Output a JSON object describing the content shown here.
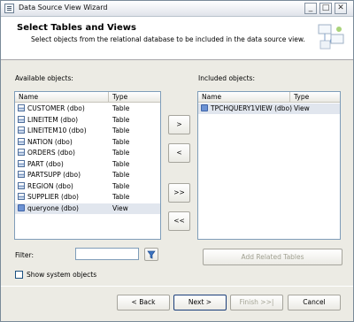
{
  "window": {
    "title": "Data Source View Wizard",
    "minimize": "_",
    "maximize": "□",
    "close": "✕"
  },
  "header": {
    "title": "Select Tables and Views",
    "subtitle": "Select objects from the relational database to be included in the data source view."
  },
  "available": {
    "label": "Available objects:",
    "columns": {
      "name": "Name",
      "type": "Type"
    },
    "rows": [
      {
        "name": "CUSTOMER (dbo)",
        "type": "Table",
        "icon": "table-icon"
      },
      {
        "name": "LINEITEM (dbo)",
        "type": "Table",
        "icon": "table-icon"
      },
      {
        "name": "LINEITEM10 (dbo)",
        "type": "Table",
        "icon": "table-icon"
      },
      {
        "name": "NATION (dbo)",
        "type": "Table",
        "icon": "table-icon"
      },
      {
        "name": "ORDERS (dbo)",
        "type": "Table",
        "icon": "table-icon"
      },
      {
        "name": "PART (dbo)",
        "type": "Table",
        "icon": "table-icon"
      },
      {
        "name": "PARTSUPP (dbo)",
        "type": "Table",
        "icon": "table-icon"
      },
      {
        "name": "REGION (dbo)",
        "type": "Table",
        "icon": "table-icon"
      },
      {
        "name": "SUPPLIER (dbo)",
        "type": "Table",
        "icon": "table-icon"
      },
      {
        "name": "queryone (dbo)",
        "type": "View",
        "icon": "view-icon"
      }
    ]
  },
  "included": {
    "label": "Included objects:",
    "columns": {
      "name": "Name",
      "type": "Type"
    },
    "rows": [
      {
        "name": "TPCHQUERY1VIEW (dbo)",
        "type": "View",
        "icon": "view-icon"
      }
    ]
  },
  "transfer": {
    "add_one": ">",
    "remove_one": "<",
    "add_all": ">>",
    "remove_all": "<<"
  },
  "filter": {
    "label": "Filter:",
    "value": "",
    "icon": "funnel-icon"
  },
  "add_related": "Add Related Tables",
  "show_system": {
    "label": "Show system objects",
    "checked": false
  },
  "footer": {
    "back": "< Back",
    "next": "Next >",
    "finish": "Finish >>|",
    "cancel": "Cancel"
  }
}
